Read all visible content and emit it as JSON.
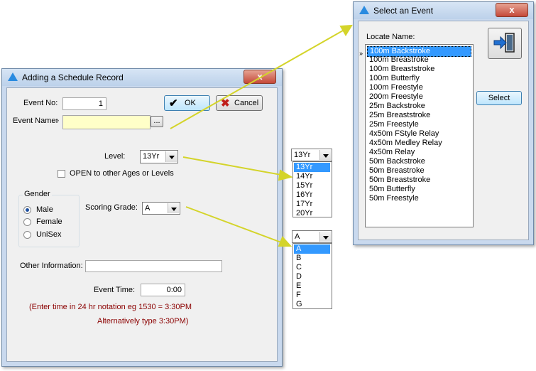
{
  "schedule_dialog": {
    "title": "Adding a Schedule Record",
    "close_label": "x",
    "event_no_label": "Event No:",
    "event_no_value": "1",
    "event_name_label": "Event Name:",
    "event_name_value": "",
    "browse_label": "...",
    "ok_label": "OK",
    "cancel_label": "Cancel",
    "level_label": "Level:",
    "level_value": "13Yr",
    "open_checkbox_label": "OPEN to other Ages or Levels",
    "gender_group_label": "Gender",
    "gender_options": [
      "Male",
      "Female",
      "UniSex"
    ],
    "scoring_grade_label": "Scoring Grade:",
    "scoring_grade_value": "A",
    "other_info_label": "Other Information:",
    "other_info_value": "",
    "event_time_label": "Event Time:",
    "event_time_value": "0:00",
    "hint_line1": "(Enter time in 24 hr notation eg 1530 = 3:30PM",
    "hint_line2": "Alternatively type 3:30PM)"
  },
  "level_dropdown": {
    "value": "13Yr",
    "options": [
      "13Yr",
      "14Yr",
      "15Yr",
      "16Yr",
      "17Yr",
      "20Yr"
    ]
  },
  "grade_dropdown": {
    "value": "A",
    "options": [
      "A",
      "B",
      "C",
      "D",
      "E",
      "F",
      "G"
    ]
  },
  "select_event_dialog": {
    "title": "Select an Event",
    "close_label": "x",
    "locate_label": "Locate Name:",
    "select_label": "Select",
    "events": [
      "100m Backstroke",
      "100m Breastroke",
      "100m Breaststroke",
      "100m Butterfly",
      "100m Freestyle",
      "200m Freestyle",
      "25m Backstroke",
      "25m Breaststroke",
      "25m Freestyle",
      "4x50m FStyle Relay",
      "4x50m Medley Relay",
      "4x50m Relay",
      "50m Backstroke",
      "50m Breastroke",
      "50m Breaststroke",
      "50m Butterfly",
      "50m Freestyle"
    ]
  },
  "colors": {
    "event_name_bg": "#ffffc8",
    "hint_text": "#8b0000",
    "arrow": "#d4d42a",
    "selection": "#3399ff"
  }
}
